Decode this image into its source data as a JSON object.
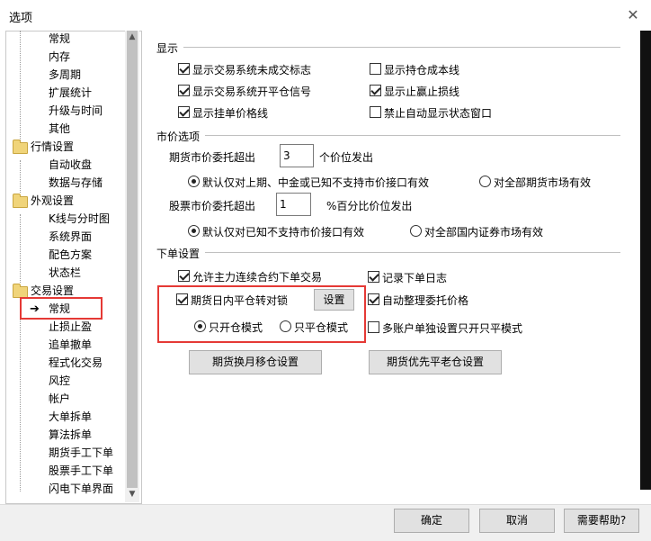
{
  "window": {
    "title": "选项",
    "close_icon": "close-icon"
  },
  "tree": {
    "items": [
      {
        "label": "常规"
      },
      {
        "label": "内存"
      },
      {
        "label": "多周期"
      },
      {
        "label": "扩展统计"
      },
      {
        "label": "升级与时间"
      },
      {
        "label": "其他"
      },
      {
        "label": "行情设置"
      },
      {
        "label": "自动收盘"
      },
      {
        "label": "数据与存储"
      },
      {
        "label": "外观设置"
      },
      {
        "label": "K线与分时图"
      },
      {
        "label": "系统界面"
      },
      {
        "label": "配色方案"
      },
      {
        "label": "状态栏"
      },
      {
        "label": "交易设置"
      },
      {
        "label": "常规"
      },
      {
        "label": "止损止盈"
      },
      {
        "label": "追单撤单"
      },
      {
        "label": "程式化交易"
      },
      {
        "label": "风控"
      },
      {
        "label": "帐户"
      },
      {
        "label": "大单拆单"
      },
      {
        "label": "算法拆单"
      },
      {
        "label": "期货手工下单"
      },
      {
        "label": "股票手工下单"
      },
      {
        "label": "闪电下单界面"
      }
    ]
  },
  "display": {
    "title": "显示",
    "options": [
      {
        "label": "显示交易系统未成交标志",
        "checked": true
      },
      {
        "label": "显示持仓成本线",
        "checked": false
      },
      {
        "label": "显示交易系统开平仓信号",
        "checked": true
      },
      {
        "label": "显示止赢止损线",
        "checked": true
      },
      {
        "label": "显示挂单价格线",
        "checked": true
      },
      {
        "label": "禁止自动显示状态窗口",
        "checked": false
      }
    ]
  },
  "market": {
    "title": "市价选项",
    "futures_label": "期货市价委托超出",
    "futures_value": "3",
    "futures_suffix": "个价位发出",
    "futures_radio1": "默认仅对上期、中金或已知不支持市价接口有效",
    "futures_radio2": "对全部期货市场有效",
    "stock_label": "股票市价委托超出",
    "stock_value": "1",
    "stock_suffix": "%百分比价位发出",
    "stock_radio1": "默认仅对已知不支持市价接口有效",
    "stock_radio2": "对全部国内证券市场有效"
  },
  "order": {
    "title": "下单设置",
    "allow_continuous": "允许主力连续合约下单交易",
    "record_log": "记录下单日志",
    "intraday_lock": "期货日内平仓转对锁",
    "settings_button": "设置",
    "auto_price": "自动整理委托价格",
    "open_only": "只开仓模式",
    "close_only": "只平仓模式",
    "multi_account": "多账户单独设置只开只平模式",
    "rollover_button": "期货换月移仓设置",
    "close_old_button": "期货优先平老仓设置"
  },
  "footer": {
    "ok": "确定",
    "cancel": "取消",
    "help": "需要帮助?"
  }
}
